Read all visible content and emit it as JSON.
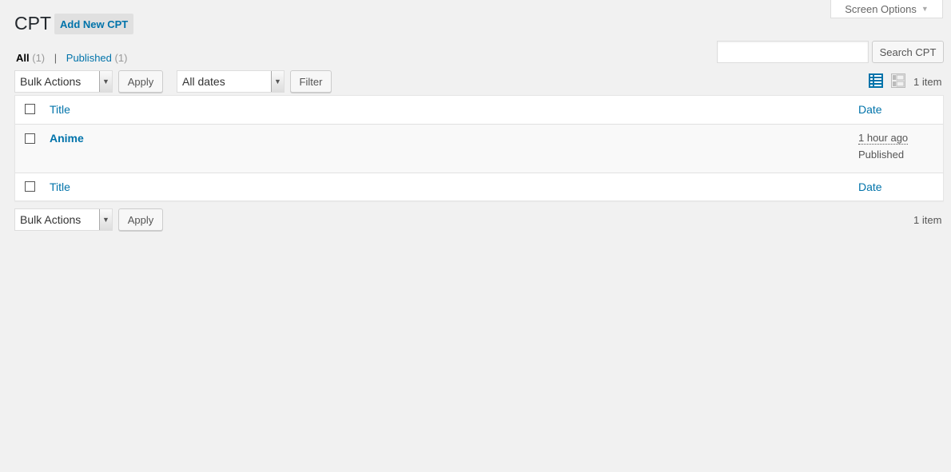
{
  "screen_options": {
    "label": "Screen Options"
  },
  "header": {
    "title": "CPT",
    "add_new_label": "Add New CPT"
  },
  "views": [
    {
      "label": "All",
      "count": "(1)",
      "current": true
    },
    {
      "label": "Published",
      "count": "(1)",
      "current": false
    }
  ],
  "search": {
    "placeholder": "",
    "button_label": "Search CPT"
  },
  "top_nav": {
    "bulk_actions": "Bulk Actions",
    "apply_label": "Apply",
    "date_filter": "All dates",
    "filter_label": "Filter",
    "items_count": "1 item"
  },
  "table": {
    "columns": {
      "title": "Title",
      "date": "Date"
    },
    "rows": [
      {
        "title": "Anime",
        "date": "1 hour ago",
        "status": "Published"
      }
    ]
  },
  "bottom_nav": {
    "bulk_actions": "Bulk Actions",
    "apply_label": "Apply",
    "items_count": "1 item"
  },
  "colors": {
    "accent": "#0073aa",
    "background": "#f1f1f1"
  },
  "icons": {
    "list_view": "list-view-icon",
    "excerpt_view": "excerpt-view-icon",
    "dropdown": "caret-down-icon"
  }
}
